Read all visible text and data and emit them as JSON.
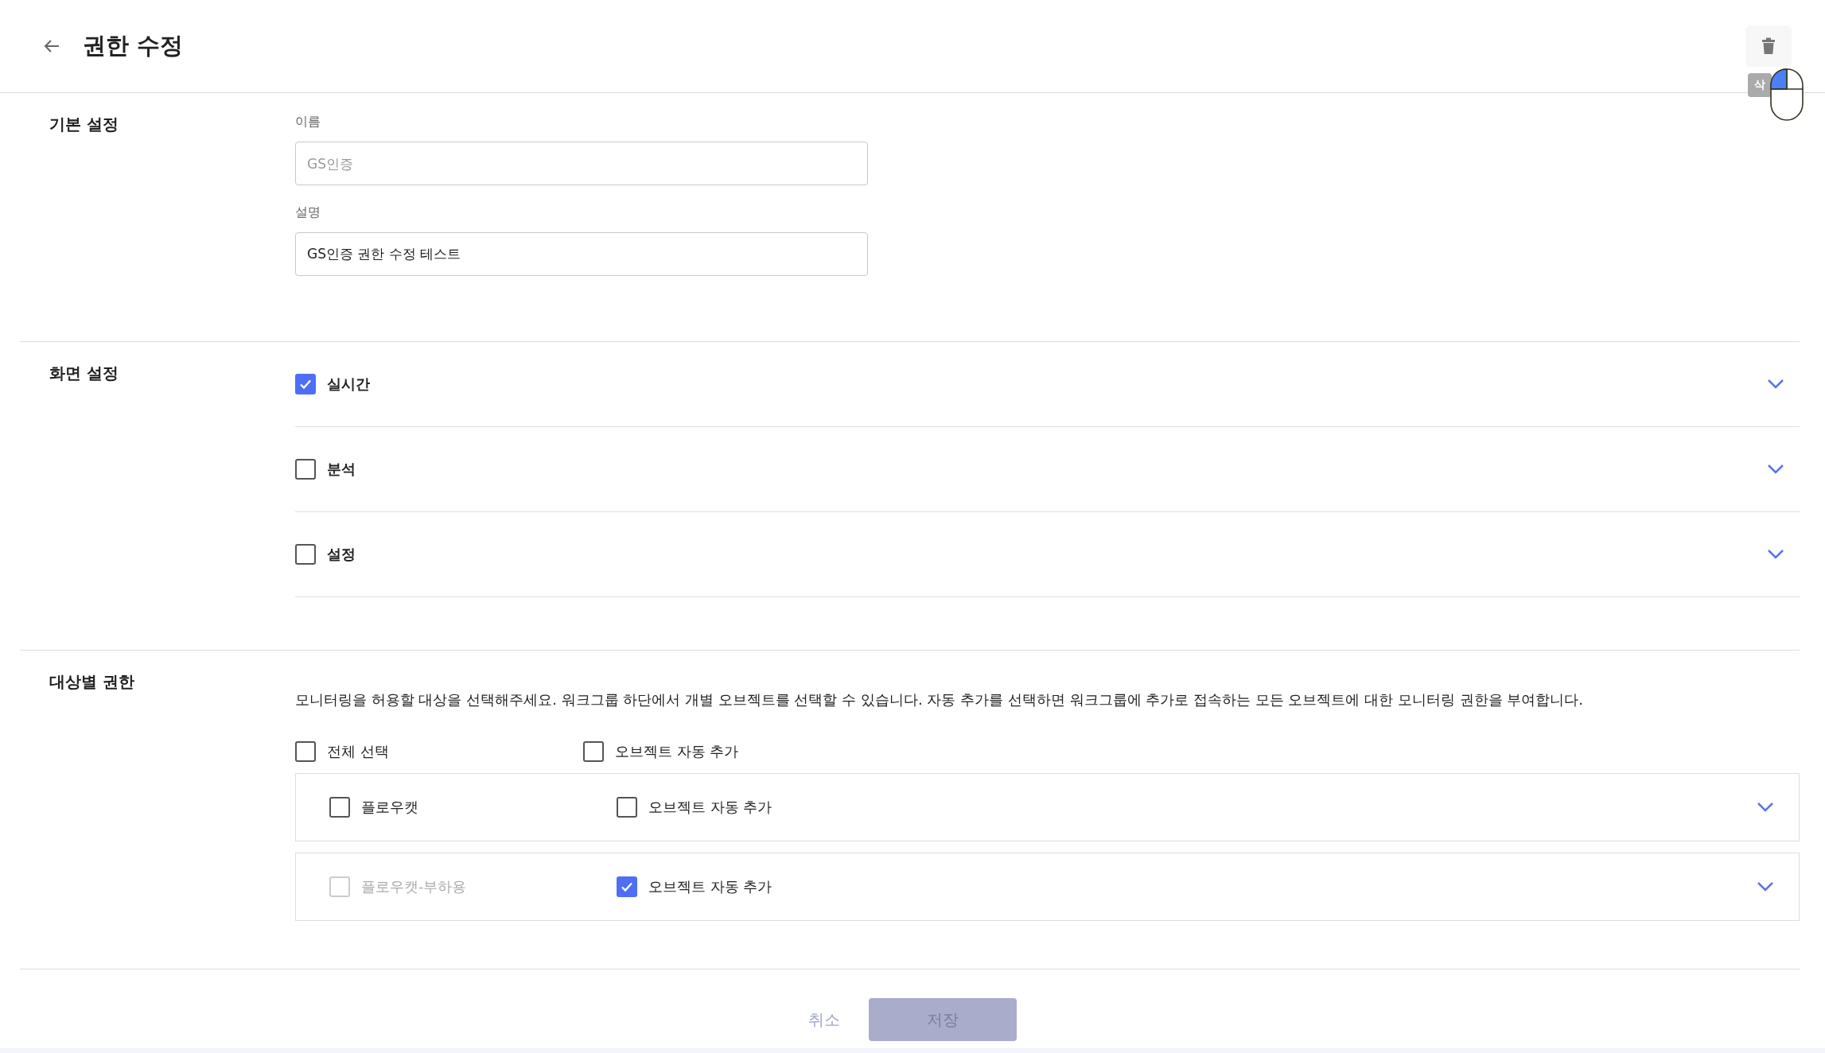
{
  "header": {
    "title": "권한 수정",
    "delete_tooltip": "삭"
  },
  "basic": {
    "label": "기본 설정",
    "fields": [
      {
        "label": "이름",
        "placeholder": "GS인증"
      },
      {
        "label": "설명",
        "value": "GS인증 권한 수정 테스트"
      }
    ]
  },
  "screen": {
    "label": "화면 설정",
    "items": [
      {
        "label": "실시간",
        "checked": true
      },
      {
        "label": "분석",
        "checked": false
      },
      {
        "label": "설정",
        "checked": false
      }
    ]
  },
  "targets": {
    "label": "대상별 권한",
    "description": "모니터링을 허용할 대상을 선택해주세요. 워크그룹 하단에서 개별 오브젝트를 선택할 수 있습니다. 자동 추가를 선택하면 워크그룹에 추가로 접속하는 모든 오브젝트에 대한 모니터링 권한을 부여합니다.",
    "select_all": {
      "label": "전체 선택",
      "checked": false
    },
    "auto_add": {
      "label": "오브젝트 자동 추가",
      "checked": false
    },
    "groups": [
      {
        "label": "플로우캣",
        "checked": false,
        "disabled": false,
        "auto_add": {
          "label": "오브젝트 자동 추가",
          "checked": false
        }
      },
      {
        "label": "플로우캣-부하용",
        "checked": false,
        "disabled": true,
        "auto_add": {
          "label": "오브젝트 자동 추가",
          "checked": true
        }
      }
    ]
  },
  "footer": {
    "cancel": "취소",
    "save": "저장",
    "save_disabled": true
  }
}
